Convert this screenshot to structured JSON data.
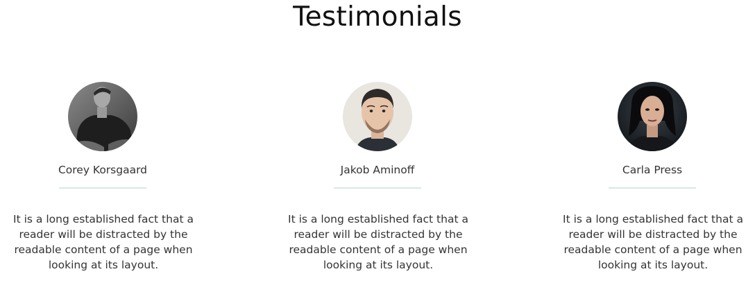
{
  "section": {
    "title": "Testimonials"
  },
  "testimonials": [
    {
      "name": "Corey Korsgaard",
      "quote": "It is a long established fact that a reader will be distracted by the readable content of a page when looking at its layout."
    },
    {
      "name": "Jakob Aminoff",
      "quote": "It is a long established fact that a reader will be distracted by the readable content of a page when looking at its layout."
    },
    {
      "name": "Carla Press",
      "quote": "It is a long established fact that a reader will be distracted by the readable content of a page when looking at its layout."
    }
  ],
  "colors": {
    "divider": "#d6e8e3",
    "text": "#333333",
    "title": "#111111"
  }
}
